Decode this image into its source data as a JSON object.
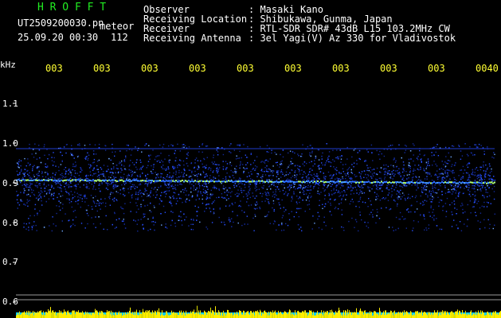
{
  "header": {
    "brand": "H R O F F T",
    "filename": "UT2509200030.pn",
    "tag": "meteor",
    "datetime": "25.09.20 00:30",
    "count": "112",
    "fields": [
      {
        "label": "Observer",
        "value": ": Masaki Kano"
      },
      {
        "label": "Receiving Location",
        "value": ": Shibukawa, Gunma, Japan"
      },
      {
        "label": "Receiver",
        "value": ": RTL-SDR SDR# 43dB L15 103.2MHz CW"
      },
      {
        "label": "Receiving Antenna",
        "value": ": 3el Yagi(V) Az 330 for Vladivostok"
      }
    ]
  },
  "axis": {
    "unit": "kHz",
    "y_ticks": [
      "1.1",
      "1.0",
      "0.9",
      "0.8",
      "0.7",
      "0.6"
    ],
    "time_ticks": [
      "003",
      "003",
      "003",
      "003",
      "003",
      "003",
      "003",
      "003",
      "003",
      "0040"
    ]
  },
  "chart_data": {
    "type": "heatmap",
    "ylabel": "kHz",
    "ylim": [
      0.6,
      1.15
    ],
    "signal_carrier_khz": 0.905,
    "noise_band_khz": [
      0.78,
      1.0
    ],
    "line_khz": 0.985,
    "colors": {
      "carrier": "#b0ff70",
      "noise": "#1a3cff",
      "bars": "#ffee00",
      "base": "#00ccff"
    }
  }
}
